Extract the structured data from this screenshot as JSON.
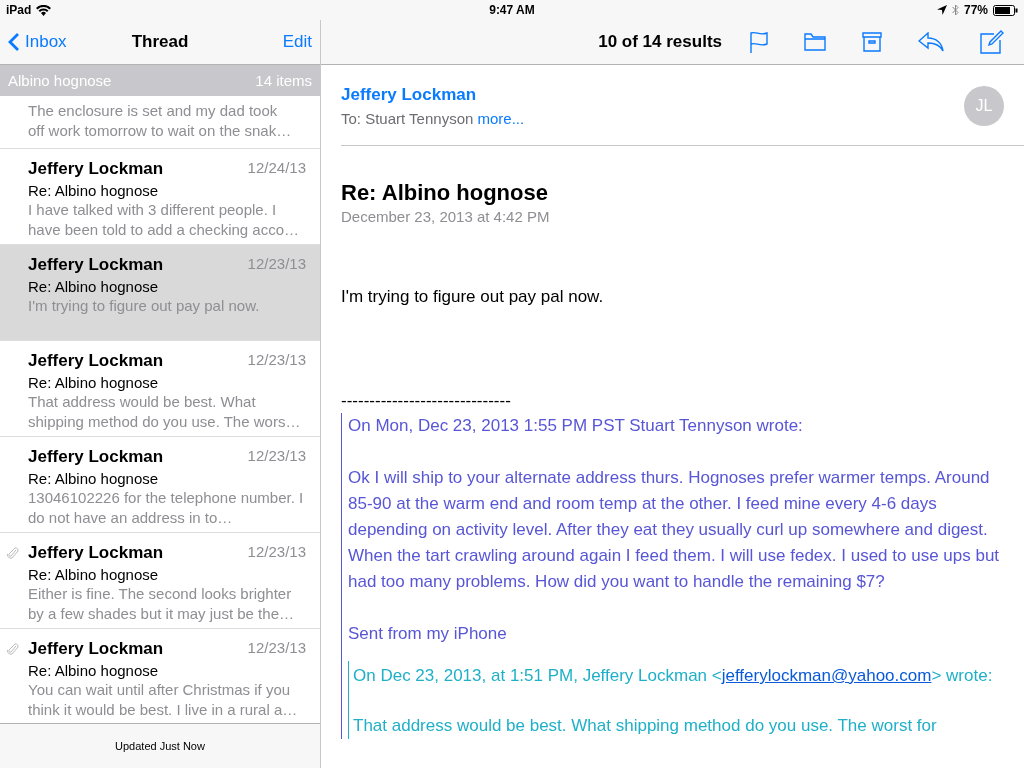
{
  "status_bar": {
    "device": "iPad",
    "time": "9:47 AM",
    "battery": "77%"
  },
  "sidebar": {
    "back": "Inbox",
    "title": "Thread",
    "edit": "Edit",
    "section": {
      "title": "Albino hognose",
      "count": "14 items"
    },
    "messages": [
      {
        "kind": "partial",
        "preview": "The enclosure is set and my dad took off work tomorrow to wait on the snak…",
        "selected": false
      },
      {
        "kind": "full",
        "sender": "Jeffery Lockman",
        "date": "12/24/13",
        "subject": "Re: Albino hognose",
        "preview": "I have talked with 3 different people. I have been told to add a checking acco…",
        "selected": false,
        "attachment": false
      },
      {
        "kind": "full",
        "sender": "Jeffery Lockman",
        "date": "12/23/13",
        "subject": "Re: Albino hognose",
        "preview": "I'm trying to figure out pay pal now.",
        "selected": true,
        "attachment": false
      },
      {
        "kind": "full",
        "sender": "Jeffery Lockman",
        "date": "12/23/13",
        "subject": "Re: Albino hognose",
        "preview": "That address would be best. What shipping method do you use. The wors…",
        "selected": false,
        "attachment": false
      },
      {
        "kind": "full",
        "sender": "Jeffery Lockman",
        "date": "12/23/13",
        "subject": "Re: Albino hognose",
        "preview": "13046102226 for the telephone number. I do not have an address in to…",
        "selected": false,
        "attachment": false
      },
      {
        "kind": "full",
        "sender": "Jeffery Lockman",
        "date": "12/23/13",
        "subject": "Re: Albino hognose",
        "preview": "Either is fine. The second looks brighter by a few shades but it may just be the…",
        "selected": false,
        "attachment": true
      },
      {
        "kind": "full",
        "sender": "Jeffery Lockman",
        "date": "12/23/13",
        "subject": "Re: Albino hognose",
        "preview": "You can wait until after Christmas if you think it would be best. I live in a rural a…",
        "selected": false,
        "attachment": true
      }
    ],
    "footer": "Updated Just Now"
  },
  "toolbar": {
    "results": "10 of 14 results"
  },
  "message": {
    "from": "Jeffery Lockman",
    "to_label": "To:",
    "to": "Stuart Tennyson",
    "more": "more...",
    "avatar": "JL",
    "subject": "Re: Albino hognose",
    "date": "December 23, 2013 at 4:42 PM",
    "body": "I'm trying to figure out pay pal now.",
    "separator": "------------------------------",
    "quote": {
      "header": "On Mon, Dec 23, 2013 1:55 PM PST Stuart Tennyson wrote:",
      "paragraph": "Ok I will ship to your alternate address thurs. Hognoses prefer warmer temps. Around 85-90 at the warm end and room temp at the other. I feed mine every 4-6 days depending on activity level. After they eat they usually curl up somewhere and digest. When the tart crawling around again I feed them. I will use fedex. I used to use ups but had too many problems. How did you want to handle the remaining $7?",
      "signature": "Sent from my iPhone",
      "inner": {
        "header_before": "On Dec 23, 2013, at 1:51 PM, Jeffery Lockman <",
        "email": "jefferylockman@yahoo.com",
        "header_after": "> wrote:",
        "text": "That address would be best. What shipping method do you use. The worst for"
      }
    }
  }
}
